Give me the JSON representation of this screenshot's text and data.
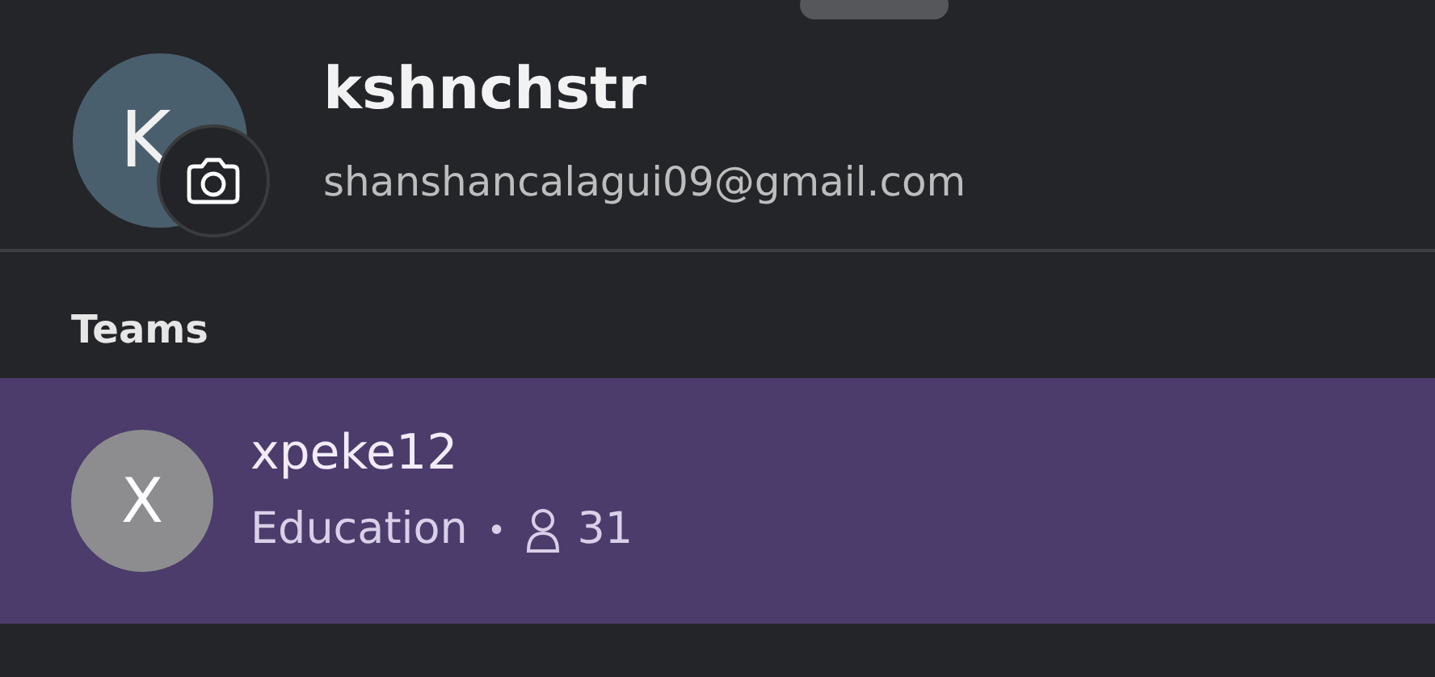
{
  "profile": {
    "initial": "K",
    "name": "kshnchstr",
    "email": "shanshancalagui09@gmail.com"
  },
  "section_title": "Teams",
  "teams": [
    {
      "initial": "X",
      "name": "xpeke12",
      "category": "Education",
      "separator": "•",
      "members": "31",
      "selected": true
    }
  ]
}
